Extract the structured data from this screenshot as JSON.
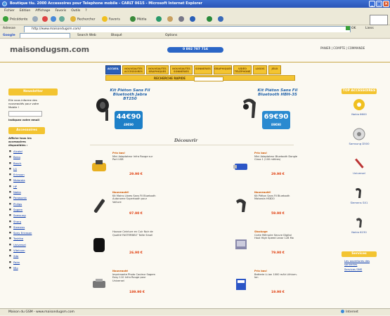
{
  "window": {
    "title": "Boutique tiu. 2000 Accessoires pour Telephone mobile - CARLT 0615 - Microsoft Internet Explorer",
    "menu": [
      "Fichier",
      "Edition",
      "Affichage",
      "Favoris",
      "Outils",
      "?"
    ],
    "toolbar": [
      "Précédente",
      "Rechercher",
      "Favoris",
      "Média"
    ],
    "address_label": "Adresse",
    "address_value": "http://www.maisondugsm.com/",
    "go_label": "OK",
    "links_label": "Liens",
    "gbar": [
      "Google",
      "Search Web",
      "Bloqué",
      "Options"
    ],
    "status": "Maison du GSM - www.maisondugsm.com",
    "zone": "Internet"
  },
  "site": {
    "logo": "maisondugsm.com",
    "phone": "0 892 707 716",
    "toplinks": [
      "PANIER",
      "COMPTE",
      "COMMANDE"
    ],
    "nav": [
      {
        "label": "ACCUEIL"
      },
      {
        "label": "NOUVEAUTÉS ACCESSOIRES"
      },
      {
        "label": "NOUVEAUTÉS GRAPHIQUES"
      },
      {
        "label": "NOUVEAUTÉS SONNERIES"
      },
      {
        "label": "SONNERIES"
      },
      {
        "label": "GRAPHIQUES"
      },
      {
        "label": "VIDÉO TÉLÉPHONE"
      },
      {
        "label": "LOGOS"
      },
      {
        "label": "JEUX"
      }
    ],
    "search_label": "RECHERCHE RAPIDE",
    "left": {
      "head": "Newsletter",
      "intro": "Elle vous informe des nouveautés pour votre Mobile !",
      "email_label": "Indiquez votre email",
      "cat_head": "Accessoires",
      "cat_sub": "Affiche tous les accessoires disponibles :",
      "items": [
        "Alcatel",
        "Benq",
        "Bosch",
        "LG",
        "Ericsson",
        "Motorola",
        "HP",
        "Nokia",
        "Panasonic",
        "Philips",
        "Sagem",
        "Samsung",
        "Sharp",
        "Siemens",
        "Sony Ericsson",
        "Toshiba",
        "Universel",
        "Vitelcom",
        "Xda",
        "Palm",
        "Mio"
      ]
    },
    "banners": [
      {
        "title": "Kit Piéton Sans Fil Bluetooth Jabra BT250",
        "price": "44€90",
        "old": "49€90"
      },
      {
        "title": "Kit Piéton Sans Fil Bluetooth HBH-35",
        "price": "69€90",
        "old": "89€90"
      }
    ],
    "decouvrir": "Découvrir",
    "products": [
      {
        "tag": "Prix bas!",
        "desc": "Mini Adaptateur Infra Rouge sur Port USB",
        "price": "29.90 €"
      },
      {
        "tag": "Prix bas!",
        "desc": "Mini Adaptateur Bluetooth Dongle Class 1 (100 mètres)",
        "price": "29.90 €"
      },
      {
        "tag": "Nouveauté!",
        "desc": "Kit Mains Libres Sans Fil Bluetooth Autonome Supertooth pour Voiture",
        "price": "97.90 €"
      },
      {
        "tag": "Nouveauté!",
        "desc": "Kit Piéton Sans Fil Bluetooth Motorola HS820",
        "price": "59.90 €"
      },
      {
        "tag": "",
        "desc": "Housse Ceinture en Cuir Noir de Qualité FASTERBELT Taille Small",
        "price": "26.90 €"
      },
      {
        "tag": "Stockage",
        "desc": "Carte Mémoire Secure Digital Haut High Speed Lexar 128 Mo",
        "price": "79.90 €"
      },
      {
        "tag": "Nouveauté",
        "desc": "Imprimante Photo Couleur Sagem Easy 110 Infra Rouge pour Universel",
        "price": "189.90 €"
      },
      {
        "tag": "Prix bas!",
        "desc": "Batterie Li-ion 1000 mAh Lithium-Ion",
        "price": "19.90 €"
      }
    ],
    "right": {
      "head": "TOP ACCESSOIRES",
      "items": [
        "Nokia 6600",
        "Samsung D500",
        "Universel",
        "Siemens SX1",
        "Nokia 6230"
      ],
      "head2": "Services",
      "links": [
        "Les ouvertures des sonneries",
        "Services SMS"
      ]
    }
  },
  "colors": {
    "accent_yellow": "#f3c431",
    "nav_blue": "#2b5fb8",
    "price_red": "#e03c0c"
  }
}
